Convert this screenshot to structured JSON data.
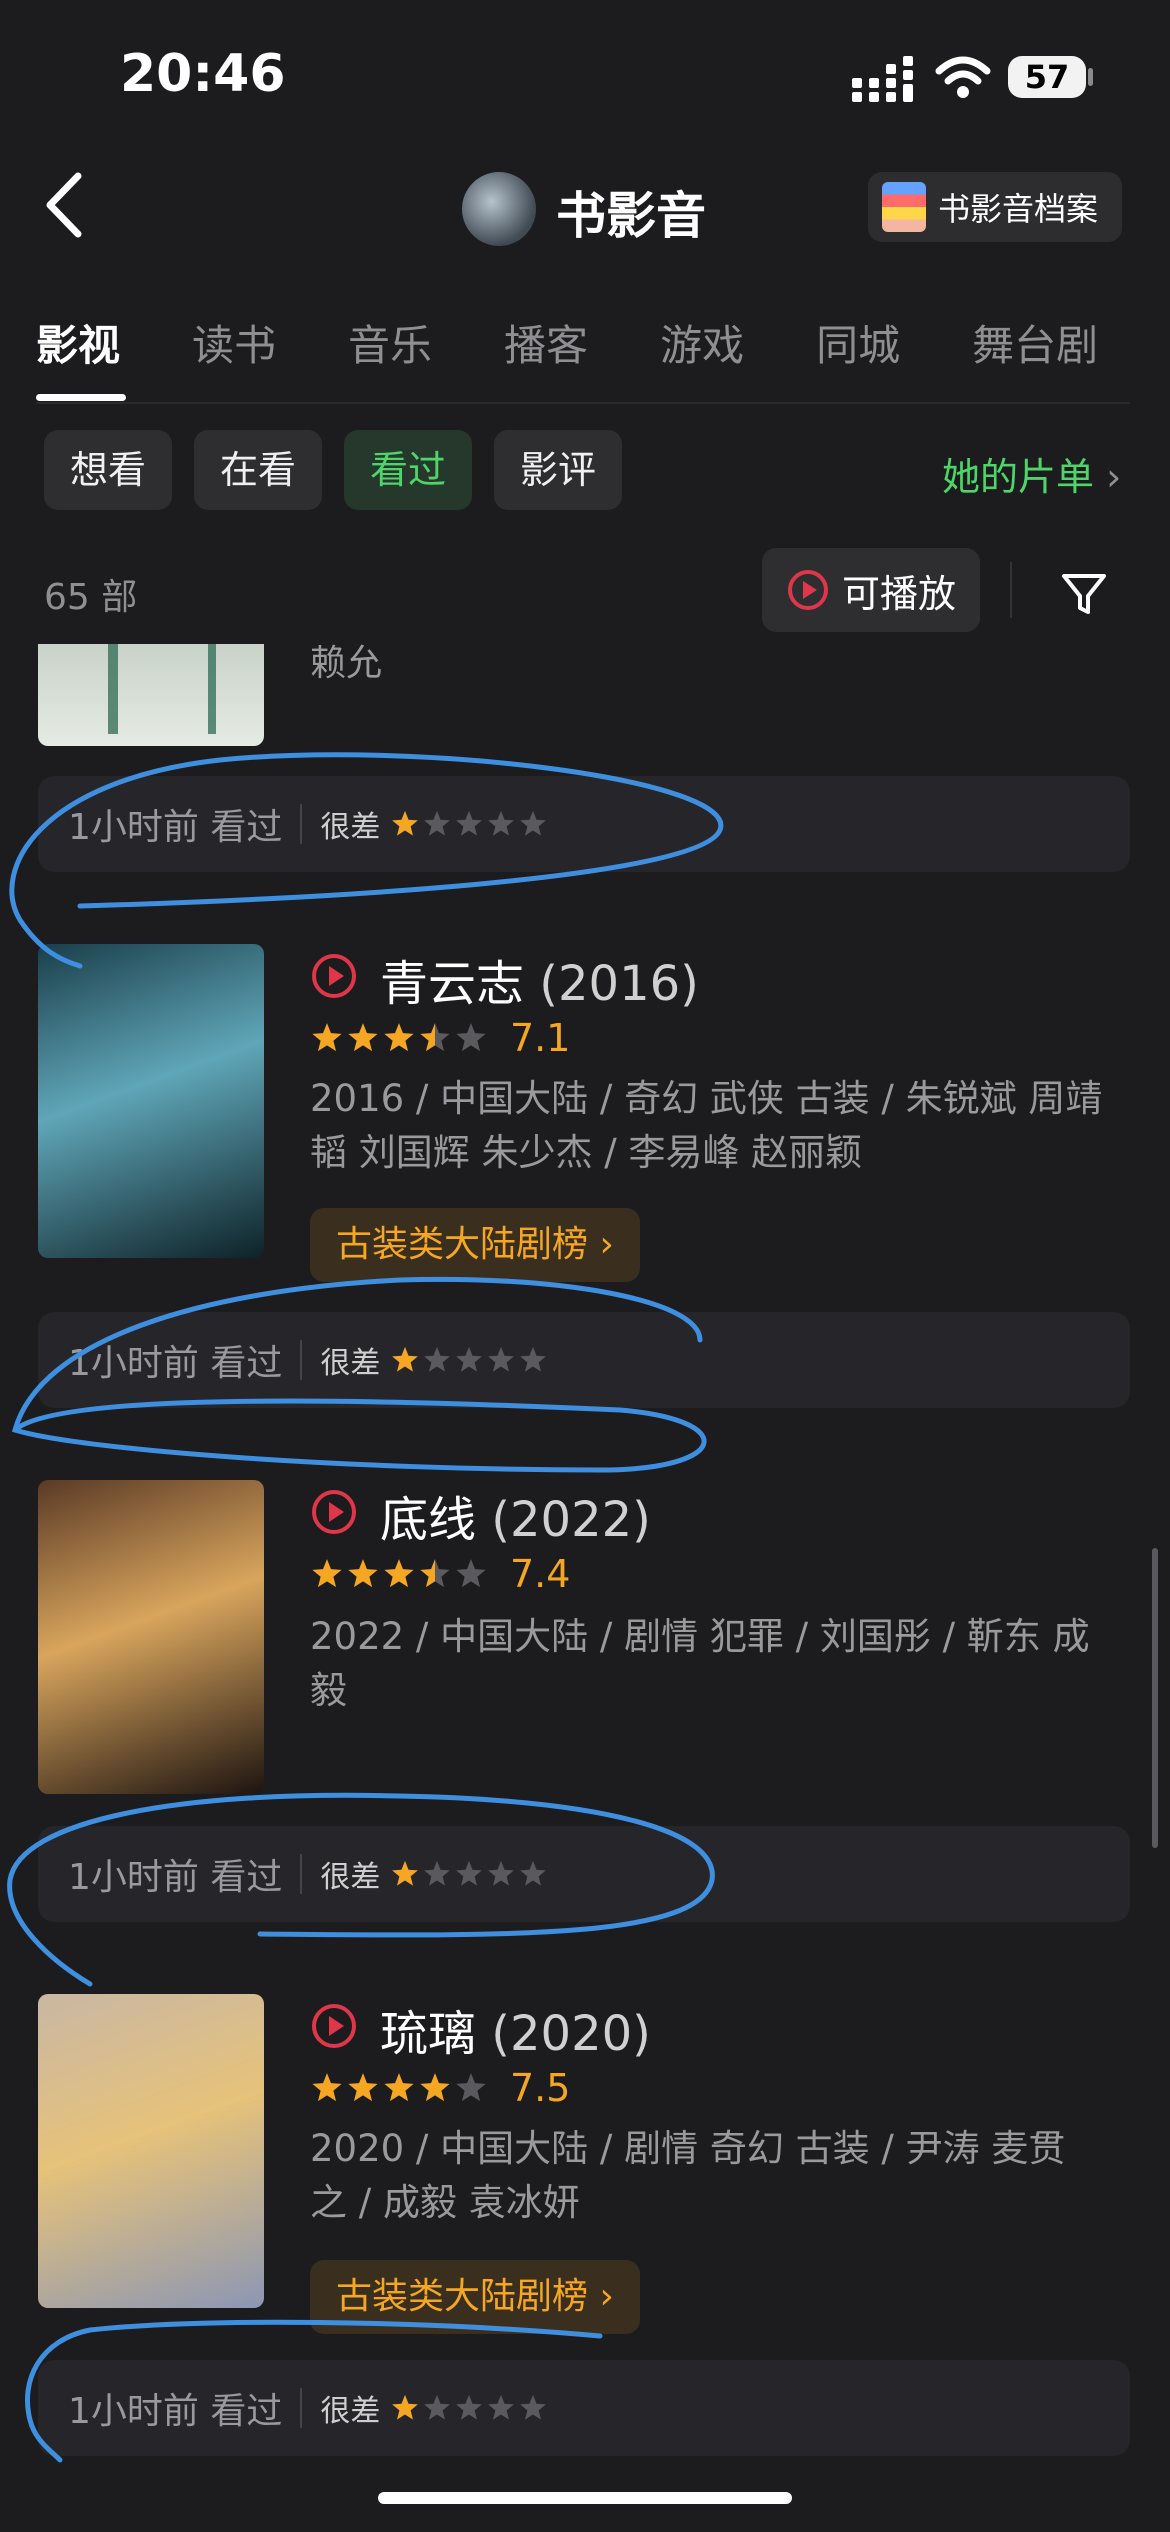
{
  "status_bar": {
    "time": "20:46",
    "battery": "57"
  },
  "header": {
    "title": "书影音",
    "archive_button": "书影音档案"
  },
  "tabs": [
    "影视",
    "读书",
    "音乐",
    "播客",
    "游戏",
    "同城",
    "舞台剧"
  ],
  "filters": {
    "chips": [
      "想看",
      "在看",
      "看过",
      "影评"
    ],
    "her_list": "她的片单"
  },
  "toolbar": {
    "count": "65 部",
    "playable": "可播放"
  },
  "partial_item": {
    "title_fragment": "赖允"
  },
  "items": [
    {
      "title": "青云志",
      "year": "(2016)",
      "score": "7.1",
      "star_value": 3.5,
      "meta_line1": "2016 / 中国大陆 / 奇幻 武侠 古装 / 朱锐斌 周靖",
      "meta_line2": "韬 刘国辉 朱少杰 / 李易峰 赵丽颖",
      "rank": "古装类大陆剧榜",
      "poster_colors": [
        "#1b3e4a",
        "#5fa6b8",
        "#0e2228"
      ]
    },
    {
      "title": "底线",
      "year": "(2022)",
      "score": "7.4",
      "star_value": 3.5,
      "meta_line1": "2022 / 中国大陆 / 剧情 犯罪 / 刘国彤 / 靳东 成",
      "meta_line2": "毅",
      "rank": "",
      "poster_colors": [
        "#5a3a26",
        "#d9a55d",
        "#1d1410"
      ]
    },
    {
      "title": "琉璃",
      "year": "(2020)",
      "score": "7.5",
      "star_value": 4,
      "meta_line1": "2020 / 中国大陆 / 剧情 奇幻 古装 / 尹涛 麦贯",
      "meta_line2": "之 / 成毅 袁冰妍",
      "rank": "古装类大陆剧榜",
      "poster_colors": [
        "#c9b7a4",
        "#e6c27a",
        "#8c96b4"
      ]
    }
  ],
  "ratings": [
    {
      "when": "1小时前 看过",
      "verdict": "很差",
      "stars": 1
    },
    {
      "when": "1小时前 看过",
      "verdict": "很差",
      "stars": 1
    },
    {
      "when": "1小时前 看过",
      "verdict": "很差",
      "stars": 1
    },
    {
      "when": "1小时前 看过",
      "verdict": "很差",
      "stars": 1
    }
  ],
  "colors": {
    "accent_green": "#4fd46a",
    "star": "#f5a623",
    "play_red": "#e0364a",
    "annotation_blue": "#3f8fe0"
  }
}
